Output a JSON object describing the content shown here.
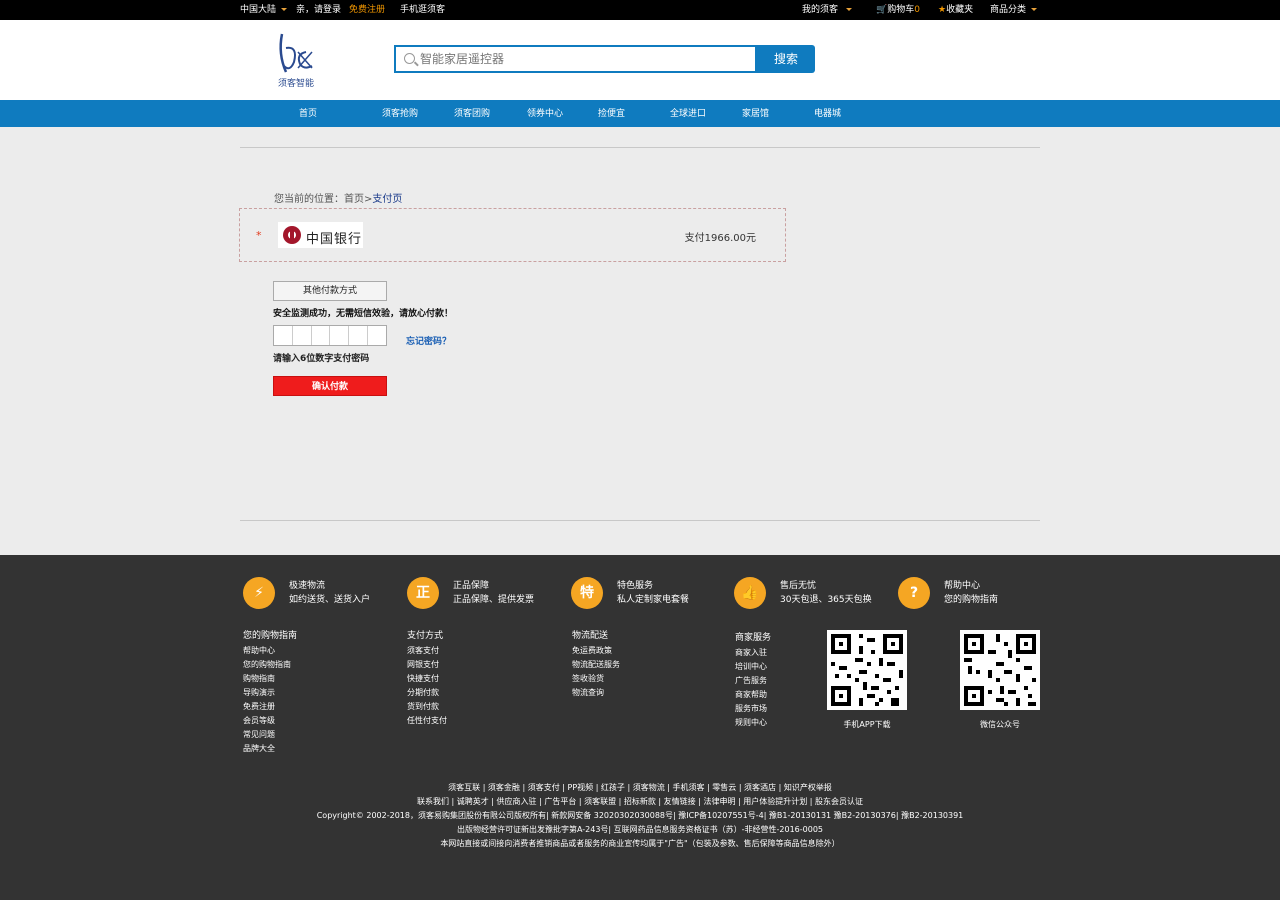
{
  "topbar": {
    "region": "中国大陆",
    "greeting": "亲，请登录",
    "register": "免费注册",
    "mobile": "手机逛须客",
    "my_account": "我的须客",
    "cart_label": "购物车",
    "cart_count": "0",
    "favorites": "收藏夹",
    "categories": "商品分类"
  },
  "header": {
    "logo_text": "须客智能",
    "search_placeholder": "智能家居遥控器",
    "search_button": "搜索"
  },
  "nav": {
    "items": [
      "首页",
      "须客抢购",
      "须客团购",
      "领券中心",
      "捡便宜",
      "全球进口",
      "家居馆",
      "电器城"
    ]
  },
  "breadcrumb": {
    "prefix": "您当前的位置：",
    "home": "首页",
    "separator": ">",
    "current": "支付页"
  },
  "payment": {
    "required_mark": "*",
    "bank_name": "中国银行",
    "amount_text": "支付1966.00元",
    "other_methods": "其他付款方式",
    "security_msg": "安全监测成功，无需短信效验，请放心付款！",
    "forgot_password": "忘记密码？",
    "password_hint": "请输入6位数字支付密码",
    "confirm_button": "确认付款"
  },
  "footer": {
    "features": [
      {
        "icon": "lightning-icon",
        "glyph": "⚡",
        "title": "极速物流",
        "desc": "如约送货、送货入户"
      },
      {
        "icon": "shield-icon",
        "glyph": "正",
        "title": "正品保障",
        "desc": "正品保障、提供发票"
      },
      {
        "icon": "special-icon",
        "glyph": "特",
        "title": "特色服务",
        "desc": "私人定制家电套餐"
      },
      {
        "icon": "thumbs-up-icon",
        "glyph": "👍",
        "title": "售后无忧",
        "desc": "30天包退、365天包换"
      },
      {
        "icon": "help-icon",
        "glyph": "?",
        "title": "帮助中心",
        "desc": "您的购物指南"
      }
    ],
    "columns": [
      {
        "title": "您的购物指南",
        "links": [
          "帮助中心",
          "您的购物指南",
          "购物指南",
          "导购演示",
          "免费注册",
          "会员等级",
          "常见问题",
          "品牌大全"
        ]
      },
      {
        "title": "支付方式",
        "links": [
          "须客支付",
          "网银支付",
          "快捷支付",
          "分期付款",
          "货到付款",
          "任性付支付"
        ]
      },
      {
        "title": "物流配送",
        "links": [
          "免运费政策",
          "物流配送服务",
          "签收验货",
          "物流查询"
        ]
      },
      {
        "title": "商家服务",
        "links": [
          "商家入驻",
          "培训中心",
          "广告服务",
          "商家帮助",
          "服务市场",
          "规则中心"
        ]
      }
    ],
    "qr_codes": [
      {
        "caption": "手机APP下载"
      },
      {
        "caption": "微信公众号"
      }
    ],
    "bottom_lines": [
      "须客互联 | 须客金融 | 须客支付 | PP视频 | 红孩子 | 须客物流 | 手机须客 | 零售云 | 须客酒店 | 知识产权举报",
      "联系我们 | 诚聘英才 | 供应商入驻 | 广告平台 | 须客联盟 | 招标新款 | 友情链接 | 法律申明 | 用户体验提升计划 | 股东会员认证",
      "Copyright© 2002-2018，须客易购集团股份有限公司版权所有| 新款网安备 32020302030088号| 豫ICP备10207551号-4| 豫B1-20130131 豫B2-20130376| 豫B2-20130391",
      "出版物经营许可证新出发豫批字第A-243号| 互联网药品信息服务资格证书（苏）-非经营性-2016-0005",
      "本网站直接或间接向消费者推销商品或者服务的商业宣传均属于\"广告\"（包装及参数、售后保障等商品信息除外）"
    ]
  }
}
